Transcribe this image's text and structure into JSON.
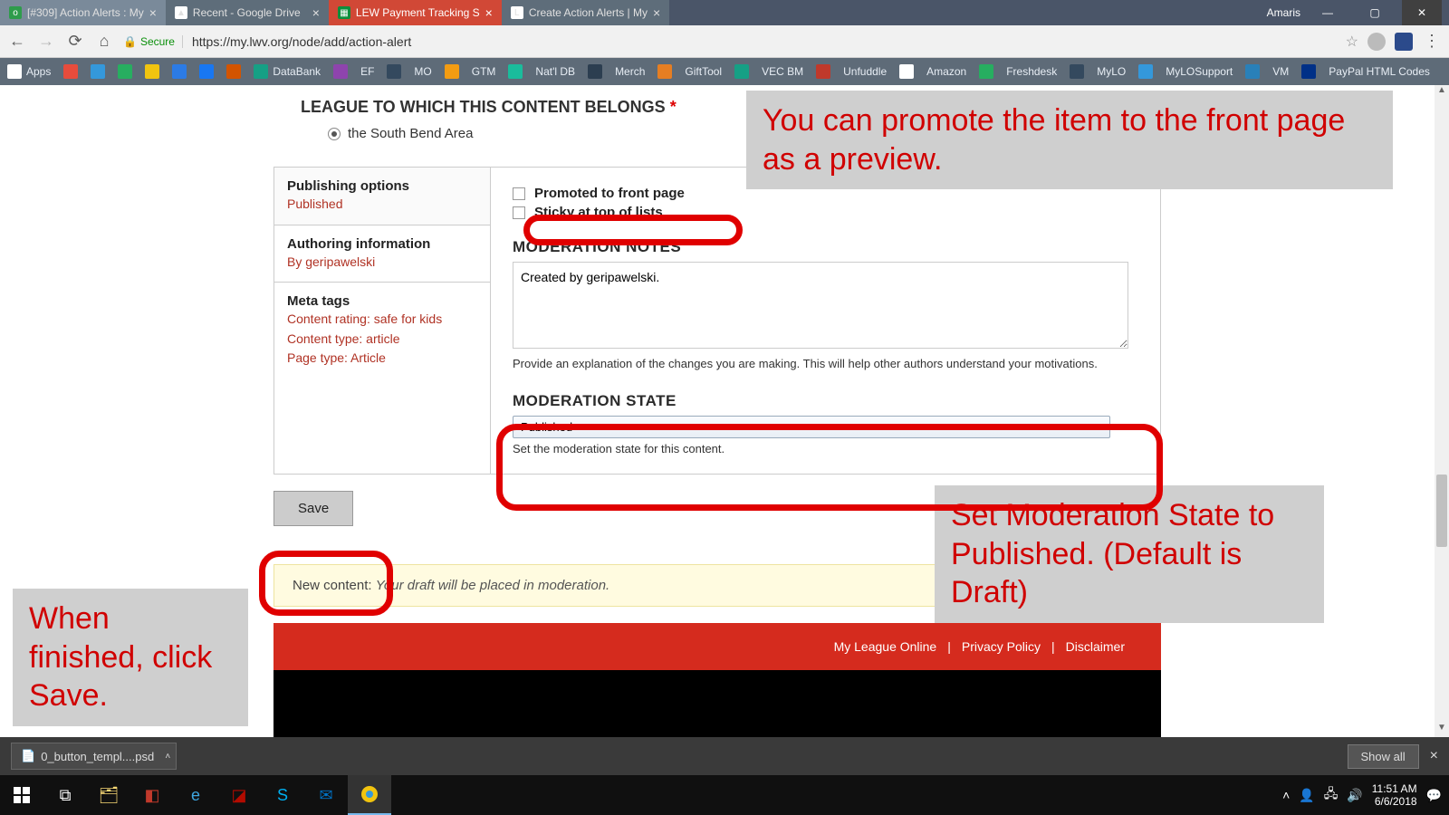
{
  "window": {
    "user": "Amaris"
  },
  "tabs": [
    {
      "label": "[#309] Action Alerts : My"
    },
    {
      "label": "Recent - Google Drive"
    },
    {
      "label": "LEW Payment Tracking S"
    },
    {
      "label": "Create Action Alerts | My"
    }
  ],
  "url": {
    "secure_label": "Secure",
    "address": "https://my.lwv.org/node/add/action-alert"
  },
  "bookmarks": [
    "Apps",
    "",
    "",
    "",
    "",
    "",
    "",
    "",
    "DataBank",
    "",
    "EF",
    "",
    "MO",
    "",
    "GTM",
    "",
    "Nat'l DB",
    "",
    "Merch",
    "",
    "GiftTool",
    "",
    "VEC BM",
    "",
    "Unfuddle",
    "",
    "Amazon",
    "",
    "Freshdesk",
    "",
    "MyLO",
    "",
    "MyLOSupport",
    "",
    "VM",
    "",
    "PayPal HTML Codes"
  ],
  "form": {
    "league_heading": "LEAGUE TO WHICH THIS CONTENT BELONGS",
    "league_value": "the South Bend Area",
    "tabs": {
      "pub_title": "Publishing options",
      "pub_sub": "Published",
      "auth_title": "Authoring information",
      "auth_sub": "By geripawelski",
      "meta_title": "Meta tags",
      "meta_sub1": "Content rating: safe for kids",
      "meta_sub2": "Content type: article",
      "meta_sub3": "Page type: Article"
    },
    "promote_label": "Promoted to front page",
    "sticky_label": "Sticky at top of lists",
    "mod_notes_heading": "MODERATION NOTES",
    "mod_notes_value": "Created by geripawelski.",
    "mod_notes_help": "Provide an explanation of the changes you are making. This will help other authors understand your motivations.",
    "mod_state_heading": "MODERATION STATE",
    "mod_state_value": "Published",
    "mod_state_help": "Set the moderation state for this content.",
    "save_label": "Save",
    "notice_prefix": "New content: ",
    "notice_text": "Your draft will be placed in moderation."
  },
  "footer": {
    "link1": "My League Online",
    "link2": "Privacy Policy",
    "link3": "Disclaimer"
  },
  "annotations": {
    "promote": "You can promote the item to the front page as a preview.",
    "state": "Set Moderation State to Published. (Default is Draft)",
    "save": "When finished, click Save."
  },
  "downloads": {
    "file": "0_button_templ....psd",
    "showall": "Show all"
  },
  "clock": {
    "time": "11:51 AM",
    "date": "6/6/2018"
  }
}
